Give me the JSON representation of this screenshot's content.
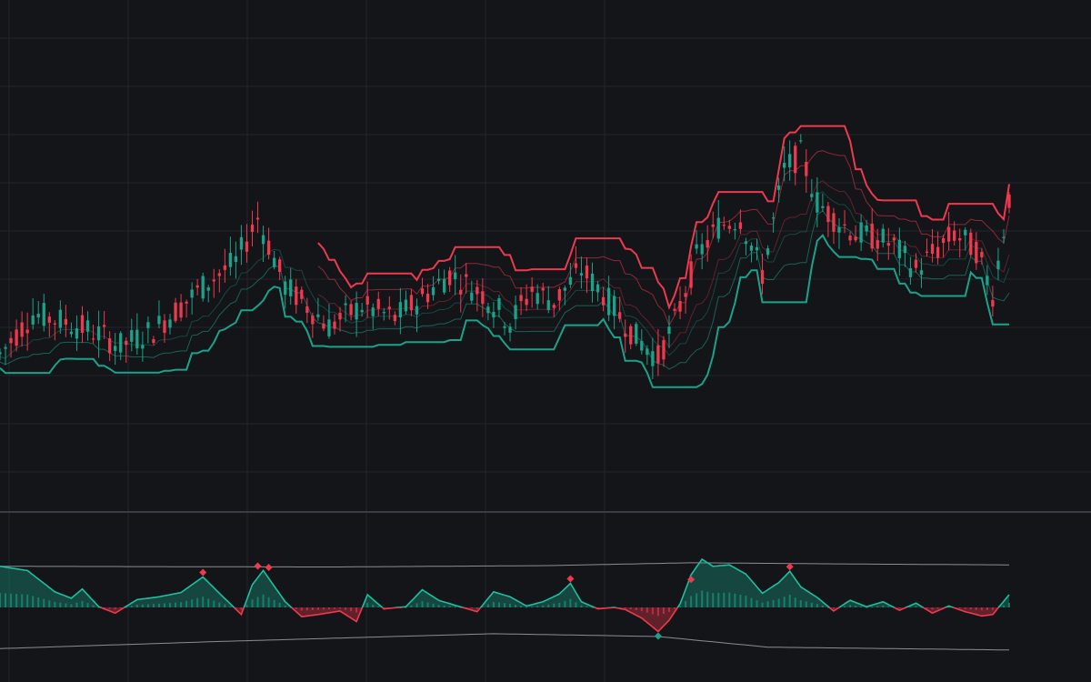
{
  "theme": {
    "background": "#141519",
    "grid": "#22252d",
    "divider": "#3a3d45",
    "up_color": "#1aa38a",
    "down_color": "#f0394e",
    "band_upper_color": "#f0394e",
    "band_lower_color": "#1aa38a",
    "osc_line_color": "#1fbf9f",
    "bounds_color": "#8a8d94"
  },
  "chart_data": [
    {
      "type": "candlestick",
      "panel": "price",
      "title": "",
      "xlabel": "",
      "ylabel": "",
      "x_range": [
        0,
        184
      ],
      "ylim": [
        0,
        100
      ],
      "grid": true,
      "legend": "none",
      "anchors": [
        [
          0,
          32
        ],
        [
          6,
          42
        ],
        [
          12,
          40
        ],
        [
          18,
          37
        ],
        [
          22,
          34
        ],
        [
          28,
          38
        ],
        [
          33,
          44
        ],
        [
          38,
          50
        ],
        [
          43,
          55
        ],
        [
          47,
          66
        ],
        [
          52,
          49
        ],
        [
          56,
          44
        ],
        [
          60,
          39
        ],
        [
          66,
          44
        ],
        [
          72,
          41
        ],
        [
          76,
          45
        ],
        [
          82,
          52
        ],
        [
          88,
          47
        ],
        [
          93,
          40
        ],
        [
          97,
          48
        ],
        [
          101,
          45
        ],
        [
          106,
          53
        ],
        [
          110,
          47
        ],
        [
          116,
          36
        ],
        [
          120,
          31
        ],
        [
          123,
          40
        ],
        [
          127,
          56
        ],
        [
          131,
          64
        ],
        [
          135,
          66
        ],
        [
          139,
          52
        ],
        [
          143,
          78
        ],
        [
          146,
          82
        ],
        [
          149,
          70
        ],
        [
          152,
          66
        ],
        [
          156,
          62
        ],
        [
          160,
          61
        ],
        [
          163,
          59
        ],
        [
          167,
          53
        ],
        [
          170,
          57
        ],
        [
          174,
          62
        ],
        [
          178,
          58
        ],
        [
          181,
          47
        ],
        [
          184,
          71
        ]
      ],
      "bands": [
        {
          "name": "upper",
          "from": 58,
          "to": 184,
          "role": "upper"
        },
        {
          "name": "lower",
          "from": 0,
          "to": 184,
          "role": "lower"
        }
      ]
    },
    {
      "type": "area",
      "panel": "oscillator",
      "title": "",
      "x_range": [
        0,
        184
      ],
      "ylim": [
        -100,
        100
      ],
      "legend": "none",
      "zero_line": 0,
      "upper_bound": [
        [
          0,
          58
        ],
        [
          60,
          57
        ],
        [
          100,
          59
        ],
        [
          126,
          63
        ],
        [
          160,
          61
        ],
        [
          184,
          60
        ]
      ],
      "lower_bound": [
        [
          0,
          -58
        ],
        [
          40,
          -48
        ],
        [
          90,
          -37
        ],
        [
          120,
          -41
        ],
        [
          140,
          -56
        ],
        [
          184,
          -60
        ]
      ],
      "anchors": [
        [
          0,
          58
        ],
        [
          5,
          52
        ],
        [
          10,
          22
        ],
        [
          13,
          13
        ],
        [
          15,
          26
        ],
        [
          18,
          1
        ],
        [
          21,
          -8
        ],
        [
          25,
          11
        ],
        [
          29,
          15
        ],
        [
          33,
          21
        ],
        [
          37,
          43
        ],
        [
          40,
          20
        ],
        [
          44,
          -10
        ],
        [
          46,
          32
        ],
        [
          48,
          52
        ],
        [
          50,
          30
        ],
        [
          52,
          8
        ],
        [
          55,
          -13
        ],
        [
          58,
          -10
        ],
        [
          62,
          -5
        ],
        [
          65,
          -20
        ],
        [
          67,
          18
        ],
        [
          70,
          -2
        ],
        [
          74,
          1
        ],
        [
          77,
          25
        ],
        [
          80,
          10
        ],
        [
          83,
          3
        ],
        [
          87,
          -6
        ],
        [
          90,
          22
        ],
        [
          93,
          15
        ],
        [
          96,
          2
        ],
        [
          99,
          8
        ],
        [
          102,
          19
        ],
        [
          104,
          34
        ],
        [
          106,
          8
        ],
        [
          109,
          -2
        ],
        [
          112,
          0
        ],
        [
          114,
          -3
        ],
        [
          117,
          -15
        ],
        [
          120,
          -34
        ],
        [
          122,
          -18
        ],
        [
          124,
          5
        ],
        [
          126,
          46
        ],
        [
          128,
          68
        ],
        [
          130,
          58
        ],
        [
          133,
          60
        ],
        [
          136,
          47
        ],
        [
          139,
          20
        ],
        [
          142,
          35
        ],
        [
          144,
          51
        ],
        [
          146,
          29
        ],
        [
          149,
          14
        ],
        [
          152,
          -5
        ],
        [
          155,
          10
        ],
        [
          158,
          1
        ],
        [
          161,
          8
        ],
        [
          164,
          -4
        ],
        [
          167,
          6
        ],
        [
          170,
          -8
        ],
        [
          173,
          2
        ],
        [
          176,
          -6
        ],
        [
          179,
          -12
        ],
        [
          181,
          -10
        ],
        [
          184,
          18
        ]
      ],
      "markers": [
        {
          "x": 37,
          "y": 43,
          "kind": "peak"
        },
        {
          "x": 47,
          "y": 52,
          "kind": "peak"
        },
        {
          "x": 49,
          "y": 50,
          "kind": "peak"
        },
        {
          "x": 104,
          "y": 34,
          "kind": "peak"
        },
        {
          "x": 120,
          "y": -34,
          "kind": "trough"
        },
        {
          "x": 126,
          "y": 33,
          "kind": "peak"
        },
        {
          "x": 144,
          "y": 51,
          "kind": "peak"
        }
      ]
    }
  ]
}
